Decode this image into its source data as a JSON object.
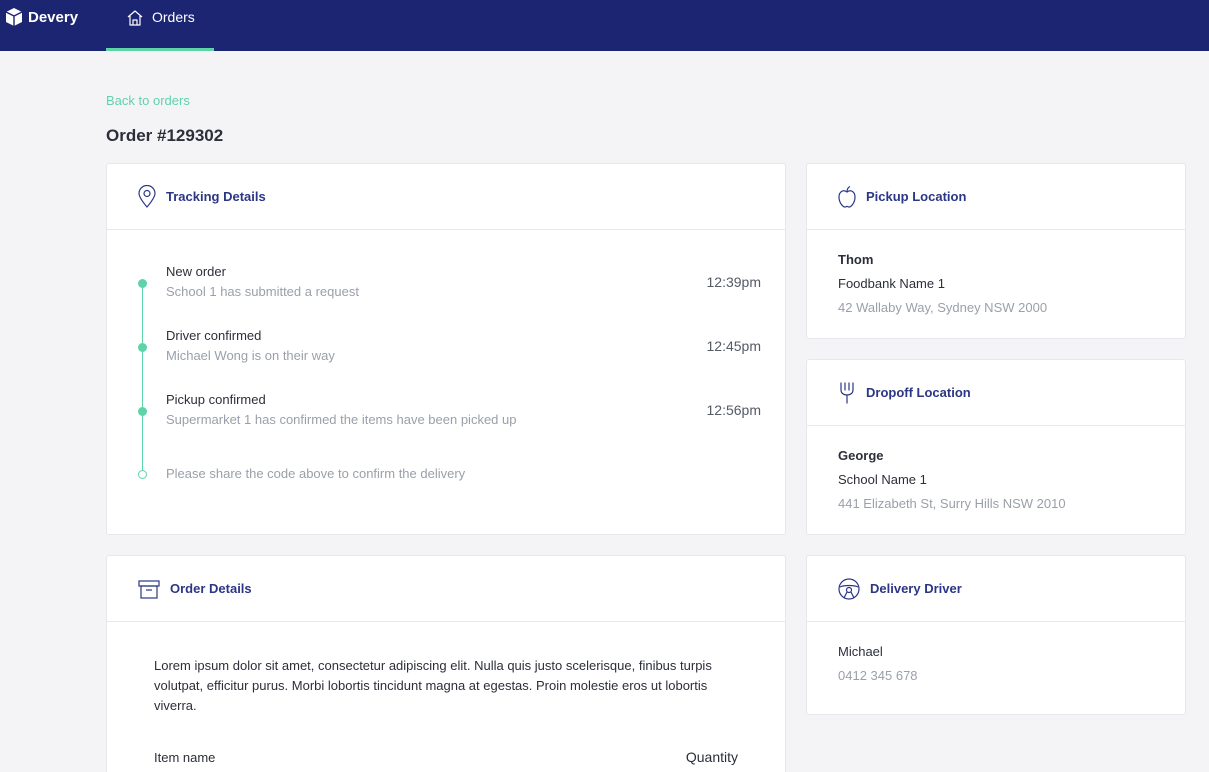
{
  "header": {
    "brand": "Devery",
    "nav_tab": "Orders"
  },
  "page": {
    "back_link": "Back to orders",
    "title": "Order #129302"
  },
  "tracking": {
    "title": "Tracking Details",
    "steps": [
      {
        "title": "New order",
        "subtitle": "School 1 has submitted a request",
        "time": "12:39pm"
      },
      {
        "title": "Driver confirmed",
        "subtitle": "Michael Wong is on their way",
        "time": "12:45pm"
      },
      {
        "title": "Pickup confirmed",
        "subtitle": "Supermarket 1 has confirmed the items have been picked up",
        "time": "12:56pm"
      }
    ],
    "pending_note": "Please share the code above to confirm the delivery"
  },
  "pickup": {
    "title": "Pickup Location",
    "name": "Thom",
    "org": "Foodbank Name 1",
    "address": "42 Wallaby Way, Sydney NSW 2000"
  },
  "dropoff": {
    "title": "Dropoff Location",
    "name": "George",
    "org": "School Name 1",
    "address": "441 Elizabeth St, Surry Hills NSW 2010"
  },
  "order": {
    "title": "Order Details",
    "description": "Lorem ipsum dolor sit amet, consectetur adipiscing elit. Nulla quis justo scelerisque, finibus turpis volutpat, efficitur purus. Morbi lobortis tincidunt magna at egestas. Proin molestie eros ut lobortis viverra.",
    "col_item": "Item name",
    "col_quantity": "Quantity"
  },
  "driver": {
    "title": "Delivery Driver",
    "name": "Michael",
    "phone": "0412 345 678"
  },
  "colors": {
    "nav_bg": "#1c2571",
    "accent": "#5fd3a8",
    "heading": "#2b3685"
  },
  "icons": {
    "brand": "cube-logo-icon",
    "nav": "home-icon",
    "tracking": "map-pin-icon",
    "pickup": "apple-icon",
    "dropoff": "fork-icon",
    "order": "archive-box-icon",
    "driver": "steering-wheel-icon"
  }
}
